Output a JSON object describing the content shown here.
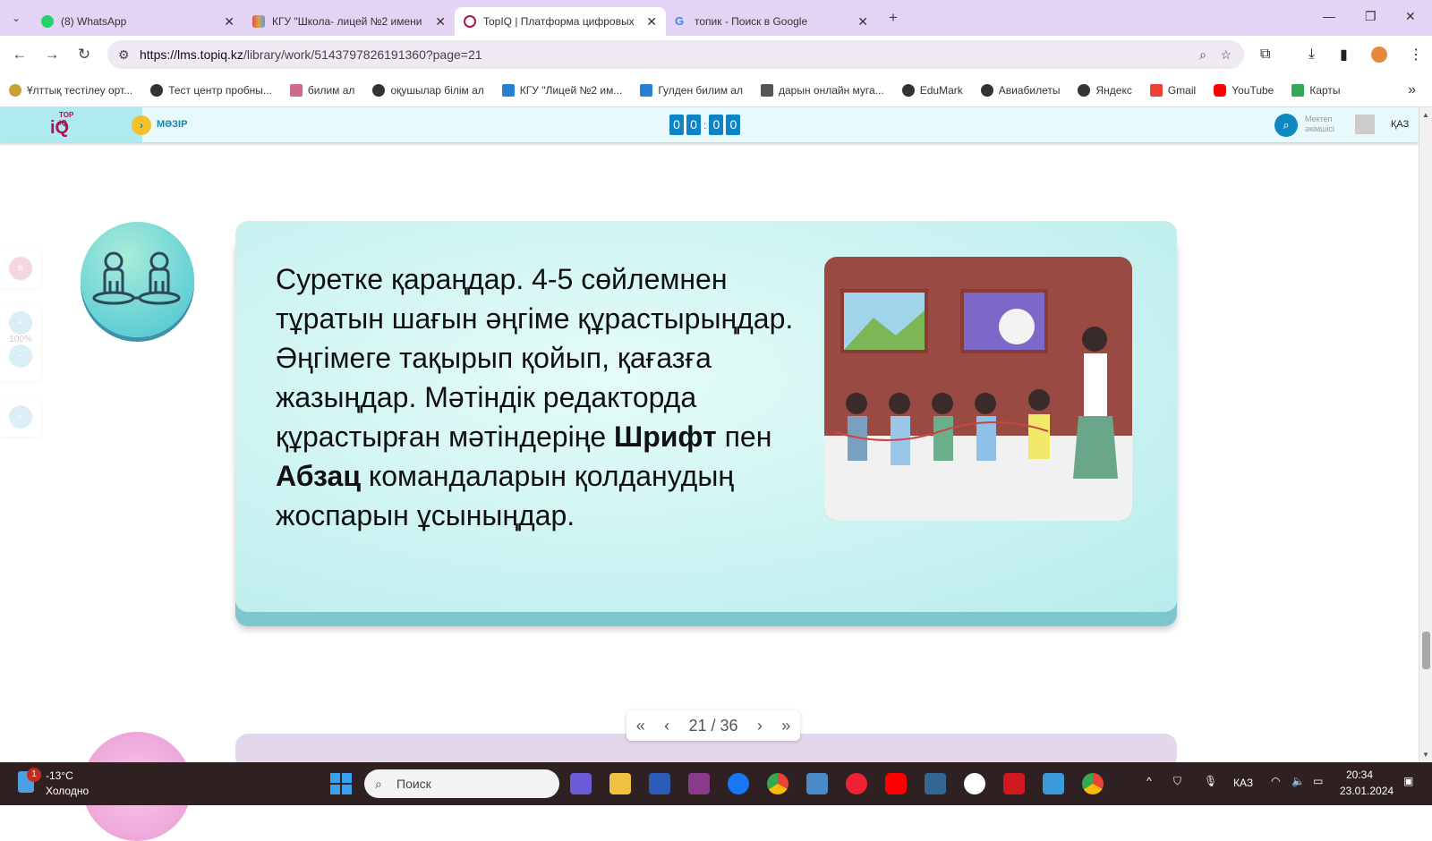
{
  "browser": {
    "tabs": [
      {
        "title": "(8) WhatsApp",
        "color": "#25d366",
        "active": false
      },
      {
        "title": "КГУ \"Школа- лицей №2 имени",
        "color": "#e0a040",
        "active": false
      },
      {
        "title": "TopIQ | Платформа цифровых",
        "color": "#b0104f",
        "active": true
      },
      {
        "title": "топик - Поиск в Google",
        "color": "#4285f4",
        "active": false
      }
    ],
    "new_tab": "+",
    "url_host": "https://lms.topiq.kz",
    "url_path": "/library/work/5143797826191360?page=21",
    "bookmarks": [
      "Ұлттық тестілеу орт...",
      "Тест центр пробны...",
      "билим ал",
      "оқушылар білім ал",
      "КГУ \"Лицей №2 им...",
      "Гулден билим ал",
      "дарын онлайн муга...",
      "EduMark",
      "Авиабилеты",
      "Яндекс",
      "Gmail",
      "YouTube",
      "Карты"
    ]
  },
  "site": {
    "logo": "TOP iQ",
    "menu_label": "МӘЗІР",
    "timer": [
      "0",
      "0",
      "0",
      "0"
    ],
    "user_role_line1": "Мектеп",
    "user_role_line2": "әкімшісі",
    "language": "ҚАЗ",
    "zoom_level": "100%"
  },
  "content": {
    "task_text_1": "Суретке қараңдар. 4-5 сөйлемнен тұратын шағын әңгіме құрастырыңдар. Әңгімеге тақырып қойып, қағазға жазыңдар. Мәтіндік редакторда құрастырған мәтіндеріңе ",
    "bold_1": "Шрифт",
    "task_text_2": " пен ",
    "bold_2": "Абзац",
    "task_text_3": " командаларын қолданудың жоспарын ұсыныңдар."
  },
  "pager": {
    "first": "«",
    "prev": "‹",
    "current": "21 / 36",
    "next": "›",
    "last": "»"
  },
  "taskbar": {
    "temperature": "-13°C",
    "weather": "Холодно",
    "badge": "1",
    "search": "Поиск",
    "lang": "КАЗ",
    "time": "20:34",
    "date": "23.01.2024"
  }
}
